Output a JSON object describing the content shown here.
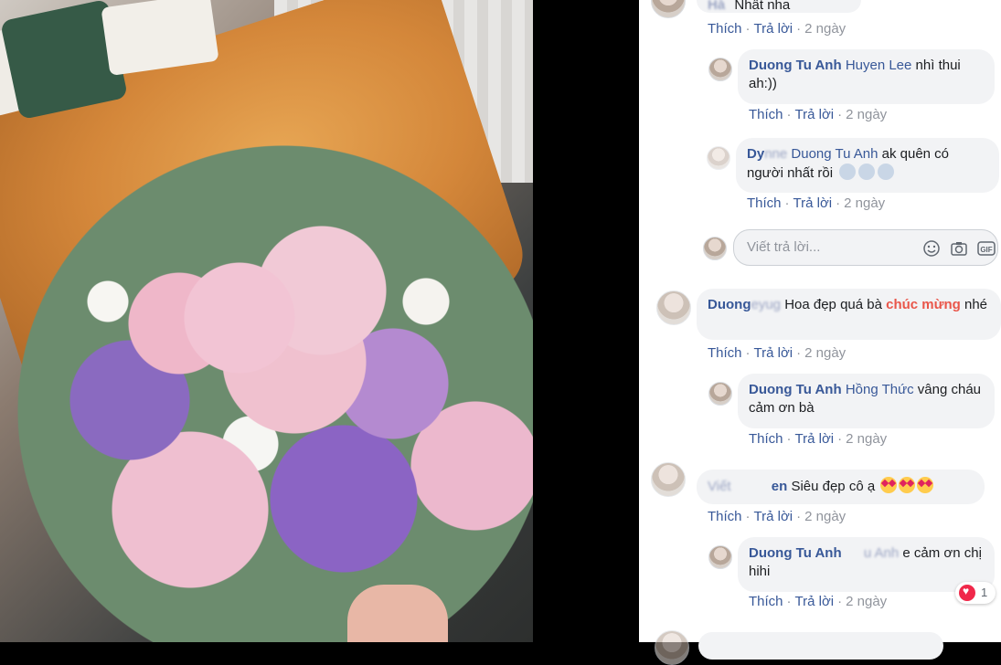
{
  "photo": {
    "description_icon": "flower-bouquet-photo"
  },
  "comments": [
    {
      "id": "c0",
      "author": "Hà",
      "author_blur": "Hà",
      "text": "Nhất nha",
      "actions": {
        "like": "Thích",
        "reply": "Trả lời",
        "time": "2 ngày"
      }
    },
    {
      "id": "r1",
      "author": "Duong Tu Anh",
      "tag": "Huyen Lee",
      "text": "nhì thui ah:))",
      "actions": {
        "like": "Thích",
        "reply": "Trả lời",
        "time": "2 ngày"
      }
    },
    {
      "id": "r2",
      "author": "Dy",
      "tag": "Duong Tu Anh",
      "text": "ak quên có người nhất rồi",
      "actions": {
        "like": "Thích",
        "reply": "Trả lời",
        "time": "2 ngày"
      }
    },
    {
      "id": "c1",
      "author": "Duong",
      "text": "Hoa đẹp quá bà",
      "highlight": "chúc mừng",
      "text_after": "nhé",
      "actions": {
        "like": "Thích",
        "reply": "Trả lời",
        "time": "2 ngày"
      }
    },
    {
      "id": "r3",
      "author": "Duong Tu Anh",
      "tag": "Hồng Thức",
      "text": "vâng cháu cảm ơn bà",
      "actions": {
        "like": "Thích",
        "reply": "Trả lời",
        "time": "2 ngày"
      }
    },
    {
      "id": "c2",
      "author": "en",
      "author_prefix": "Viết",
      "text": "Siêu đẹp cô ạ",
      "actions": {
        "like": "Thích",
        "reply": "Trả lời",
        "time": "2 ngày"
      }
    },
    {
      "id": "r4",
      "author": "Duong Tu Anh",
      "tag": "u Anh",
      "text_end": "e",
      "text": "cảm ơn chị hihi",
      "reactions": "1",
      "actions": {
        "like": "Thích",
        "reply": "Trả lời",
        "time": "2 ngày"
      }
    }
  ],
  "reply_input": {
    "placeholder": "Viết trả lời..."
  },
  "colors": {
    "link": "#385898",
    "highlight": "#e9564a",
    "bubble": "#f2f3f5"
  }
}
